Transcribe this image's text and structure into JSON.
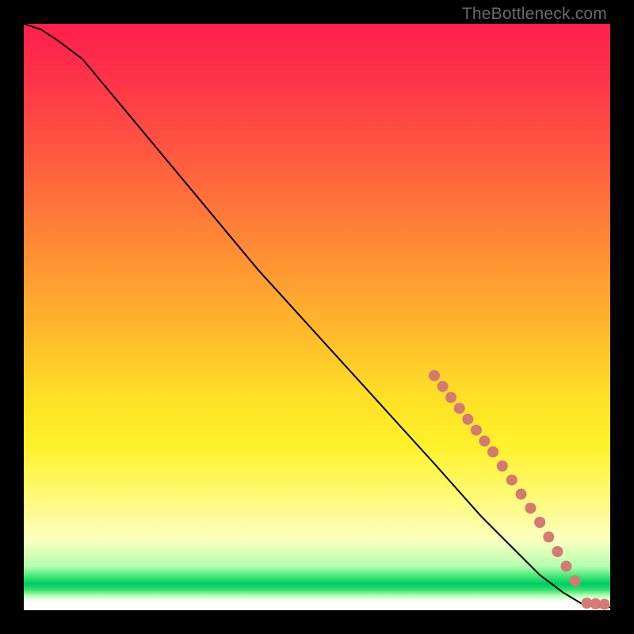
{
  "watermark": "TheBottleneck.com",
  "chart_data": {
    "type": "line",
    "title": "",
    "xlabel": "",
    "ylabel": "",
    "xlim": [
      0,
      100
    ],
    "ylim": [
      0,
      100
    ],
    "grid": false,
    "legend": false,
    "curve": {
      "name": "bottleneck-curve",
      "color": "#000000",
      "x": [
        0,
        3,
        6,
        10,
        20,
        30,
        40,
        50,
        60,
        70,
        78,
        84,
        88,
        92,
        95,
        97.5,
        100
      ],
      "y": [
        100,
        99,
        97,
        94,
        82,
        70,
        58,
        47,
        36,
        25,
        16,
        10,
        6,
        3,
        1.2,
        0.5,
        0.5
      ]
    },
    "dot_segments": [
      {
        "name": "upper-cluster",
        "x_start": 70,
        "y_start": 40,
        "x_end": 80,
        "y_end": 27,
        "count": 8
      },
      {
        "name": "mid-cluster",
        "x_start": 80,
        "y_start": 27,
        "x_end": 88,
        "y_end": 15,
        "count": 6
      },
      {
        "name": "lower-cluster",
        "x_start": 88,
        "y_start": 15,
        "x_end": 94,
        "y_end": 5,
        "count": 5
      },
      {
        "name": "tail-pair",
        "x_start": 96,
        "y_start": 1.2,
        "x_end": 99,
        "y_end": 1.0,
        "count": 3
      }
    ],
    "dot_style": {
      "color": "#d47a72",
      "radius_px": 7
    }
  }
}
